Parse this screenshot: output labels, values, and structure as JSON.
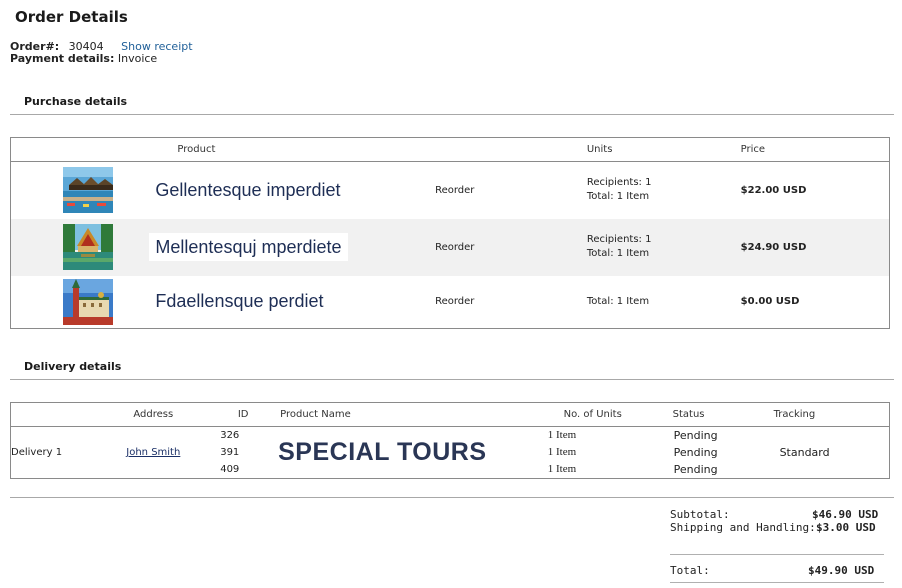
{
  "page": {
    "title": "Order Details"
  },
  "order": {
    "number_label": "Order#:",
    "number": "30404",
    "receipt_link": "Show receipt",
    "payment_label": "Payment details:",
    "payment_value": "Invoice"
  },
  "purchase": {
    "heading": "Purchase details",
    "columns": {
      "product": "Product",
      "units": "Units",
      "price": "Price"
    },
    "rows": [
      {
        "name": "Gellentesque imperdiet",
        "action": "Reorder",
        "recipients": "Recipients: 1",
        "total": "Total: 1 Item",
        "price": "$22.00 USD",
        "image": "beach-huts-image"
      },
      {
        "name": "Mellentesquj mperdiete",
        "action": "Reorder",
        "recipients": "Recipients: 1",
        "total": "Total: 1 Item",
        "price": "$24.90 USD",
        "image": "temple-image"
      },
      {
        "name": "Fdaellensque perdiet",
        "action": "Reorder",
        "recipients": "",
        "total": "Total: 1 Item",
        "price": "$0.00 USD",
        "image": "kremlin-image"
      }
    ]
  },
  "delivery": {
    "heading": "Delivery details",
    "columns": {
      "address": "Address",
      "id": "ID",
      "product_name": "Product Name",
      "units": "No. of Units",
      "status": "Status",
      "tracking": "Tracking"
    },
    "label": "Delivery 1",
    "address_link": "John Smith",
    "ids": [
      "326",
      "391",
      "409"
    ],
    "product_name": "SPECIAL TOURS",
    "units": [
      "1 Item",
      "1 Item",
      "1 Item"
    ],
    "statuses": [
      "Pending",
      "Pending",
      "Pending"
    ],
    "tracking": "Standard"
  },
  "summary": {
    "subtotal_label": "Subtotal:",
    "subtotal": "$46.90 USD",
    "shipping_label": "Shipping and Handling:",
    "shipping": "$3.00 USD",
    "total_label": "Total:",
    "total": "$49.90 USD"
  }
}
